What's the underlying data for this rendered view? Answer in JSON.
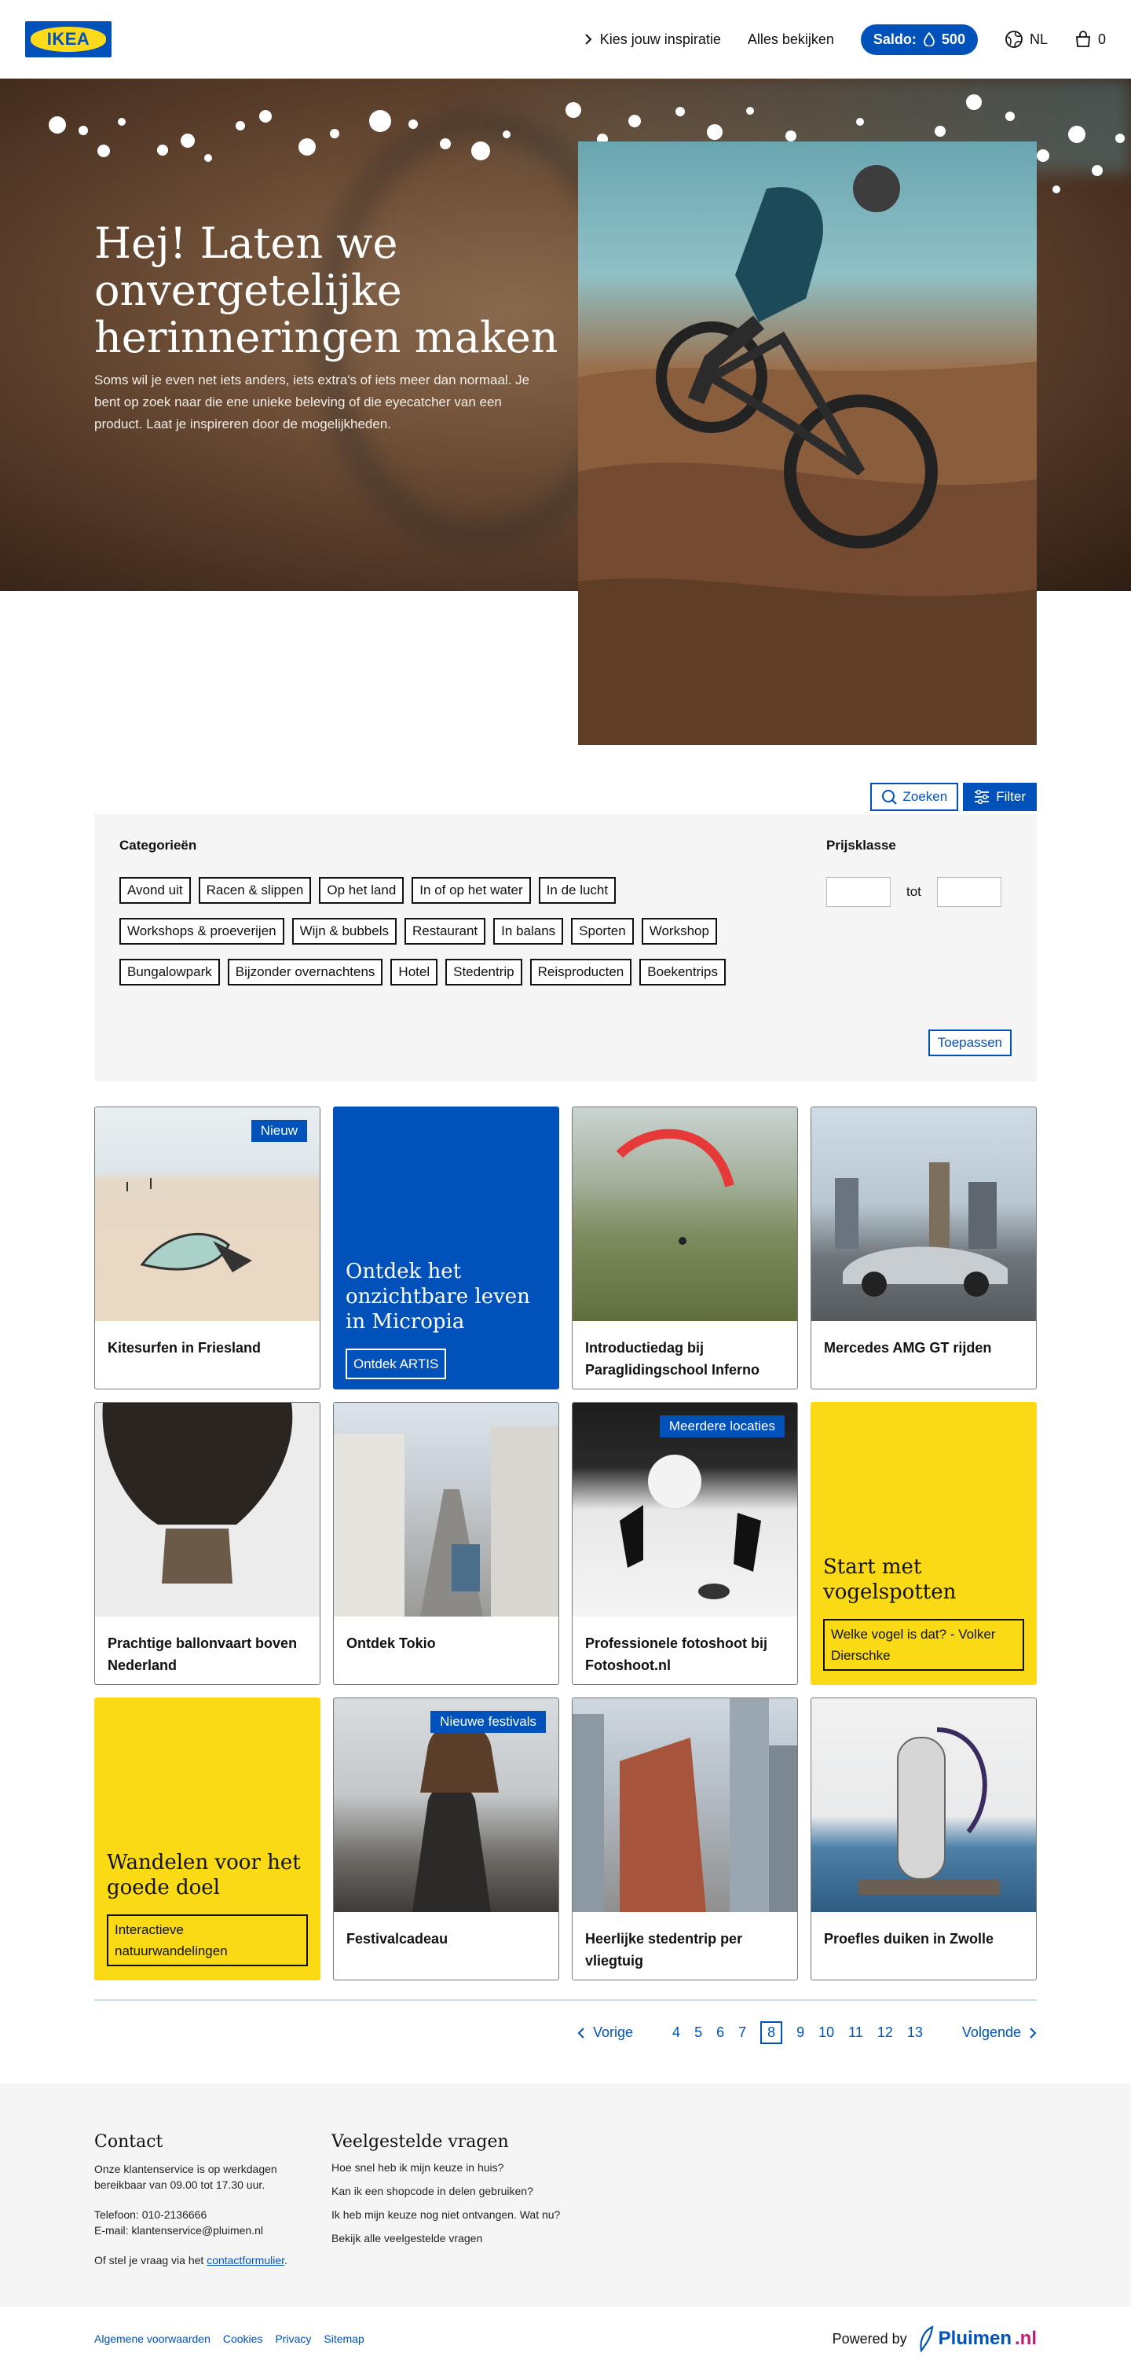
{
  "header": {
    "logo_text": "IKEA",
    "nav_inspiration": "Kies jouw inspiratie",
    "nav_all": "Alles bekijken",
    "saldo_label": "Saldo:",
    "saldo_value": "500",
    "language": "NL",
    "cart_count": "0"
  },
  "hero": {
    "title": "Hej! Laten we onvergetelijke herinneringen maken",
    "text": "Soms wil je even net iets anders, iets extra's of iets meer dan normaal. Je bent op zoek naar die ene unieke beleving of die eyecatcher van een product. Laat je inspireren door de mogelijkheden."
  },
  "search": {
    "search_label": "Zoeken",
    "filter_label": "Filter"
  },
  "filters": {
    "categories_label": "Categorieën",
    "rows": [
      [
        "Avond uit",
        "Racen & slippen",
        "Op het land",
        "In of op het water",
        "In de lucht"
      ],
      [
        "Workshops & proeverijen",
        "Wijn & bubbels",
        "Restaurant",
        "In balans",
        "Sporten",
        "Workshop"
      ],
      [
        "Bungalowpark",
        "Bijzonder overnachtens",
        "Hotel",
        "Stedentrip",
        "Reisproducten",
        "Boekentrips"
      ]
    ],
    "price_label": "Prijsklasse",
    "price_between": "tot",
    "apply_label": "Toepassen"
  },
  "cards": {
    "kitesurf": {
      "title": "Kitesurfen in Friesland",
      "badge": "Nieuw"
    },
    "micropia": {
      "title": "Ontdek het onzichtbare leven in Micropia",
      "button": "Ontdek ARTIS"
    },
    "paragliding": {
      "title": "Introductiedag bij Paraglidingschool Inferno"
    },
    "mercedes": {
      "title": "Mercedes AMG GT rijden"
    },
    "balloon": {
      "title": "Prachtige ballonvaart boven Nederland"
    },
    "tokio": {
      "title": "Ontdek Tokio"
    },
    "fotoshoot": {
      "title": "Professionele fotoshoot bij Fotoshoot.nl",
      "badge": "Meerdere locaties"
    },
    "vogels": {
      "title": "Start met vogelspotten",
      "button": "Welke vogel is dat? - Volker Dierschke"
    },
    "wandelen": {
      "title": "Wandelen voor het goede doel",
      "button": "Interactieve natuurwandelingen"
    },
    "festival": {
      "title": "Festivalcadeau",
      "badge": "Nieuwe festivals"
    },
    "stedentrip": {
      "title": "Heerlijke stedentrip per vliegtuig"
    },
    "duiken": {
      "title": "Proefles duiken in Zwolle"
    }
  },
  "pagination": {
    "prev": "Vorige",
    "next": "Volgende",
    "pages": [
      "4",
      "5",
      "6",
      "7",
      "8",
      "9",
      "10",
      "11",
      "12",
      "13"
    ],
    "current": "8"
  },
  "footer": {
    "contact_title": "Contact",
    "contact_hours": "Onze klantenservice is op werkdagen bereikbaar van 09.00 tot 17.30 uur.",
    "phone": "Telefoon: 010-2136666",
    "email": "E-mail: klantenservice@pluimen.nl",
    "contact_form_prefix": "Of stel je vraag via het",
    "contact_form_link": "contactformulier",
    "contact_form_suffix": ".",
    "faq_title": "Veelgestelde vragen",
    "faq": [
      "Hoe snel heb ik mijn keuze in huis?",
      "Kan ik een shopcode in delen gebruiken?",
      "Ik heb mijn keuze nog niet ontvangen. Wat nu?",
      "Bekijk alle veelgestelde vragen"
    ],
    "links": [
      "Algemene voorwaarden",
      "Cookies",
      "Privacy",
      "Sitemap"
    ],
    "powered_by": "Powered by",
    "brand_main": "Pluimen",
    "brand_tld": ".nl"
  },
  "colors": {
    "accent_blue": "#0051ba",
    "accent_yellow": "#fada14",
    "panel_grey": "#f5f5f5"
  }
}
